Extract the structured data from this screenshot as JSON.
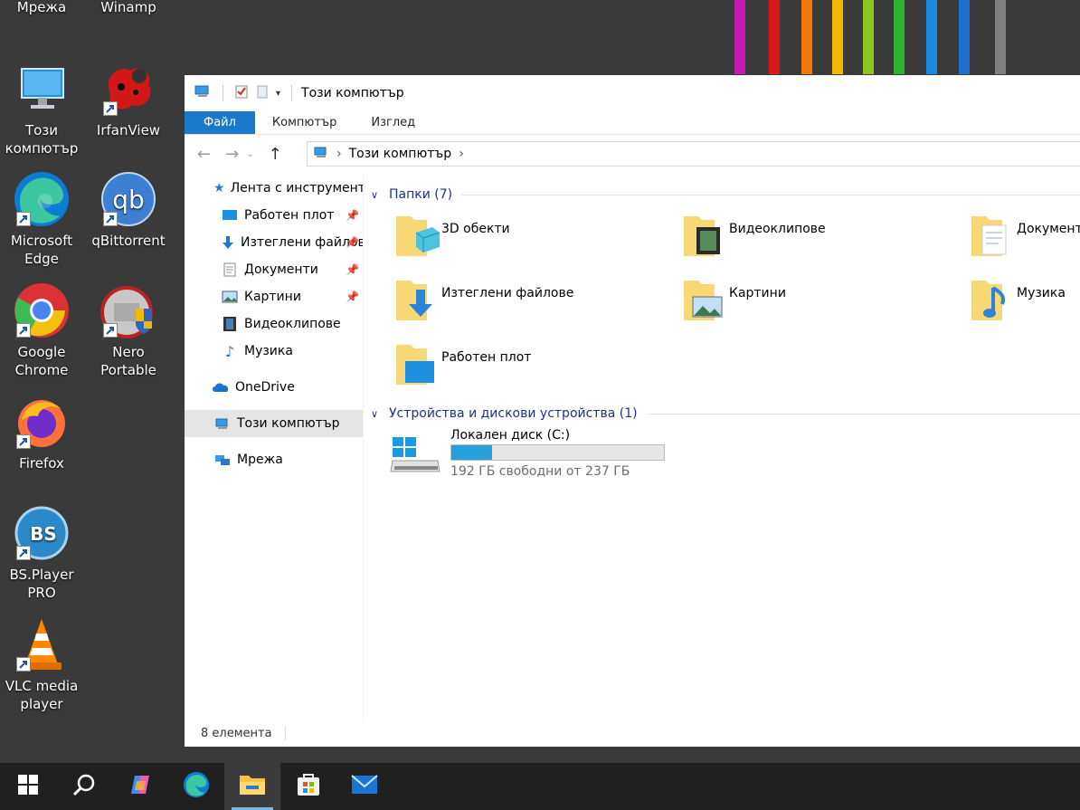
{
  "desktop": {
    "icons": [
      {
        "label": "Мрежа"
      },
      {
        "label": "Winamp"
      },
      {
        "label": "Този компютър"
      },
      {
        "label": "IrfanView"
      },
      {
        "label": "Microsoft Edge"
      },
      {
        "label": "qBittorrent"
      },
      {
        "label": "Google Chrome"
      },
      {
        "label": "Nero Portable"
      },
      {
        "label": "Firefox"
      },
      {
        "label": "BS.Player PRO"
      },
      {
        "label": "VLC media player"
      }
    ],
    "stripe_colors": [
      "#c51ab8",
      "#d81818",
      "#f0780a",
      "#f5b800",
      "#8fc41e",
      "#2bb52f",
      "#1a8be0",
      "#1e6fd0",
      "#808080"
    ]
  },
  "window": {
    "title": "Този компютър",
    "ribbon_tabs": [
      "Файл",
      "Компютър",
      "Изглед"
    ],
    "address": {
      "segment": "Този компютър"
    },
    "sidebar": {
      "items": [
        {
          "label": "Лента с инструменти"
        },
        {
          "label": "Работен плот"
        },
        {
          "label": "Изтеглени файлове"
        },
        {
          "label": "Документи"
        },
        {
          "label": "Картини"
        },
        {
          "label": "Видеоклипове"
        },
        {
          "label": "Музика"
        },
        {
          "label": "OneDrive"
        },
        {
          "label": "Този компютър"
        },
        {
          "label": "Мрежа"
        }
      ]
    },
    "folders_group": {
      "header": "Папки (7)",
      "items": [
        {
          "label": "3D обекти"
        },
        {
          "label": "Видеоклипове"
        },
        {
          "label": "Документи"
        },
        {
          "label": "Изтеглени файлове"
        },
        {
          "label": "Картини"
        },
        {
          "label": "Музика"
        },
        {
          "label": "Работен плот"
        }
      ]
    },
    "drives_group": {
      "header": "Устройства и дискови устройства (1)",
      "drive": {
        "label": "Локален диск (C:)",
        "free_text": "192 ГБ свободни от 237 ГБ",
        "used_fraction": 0.19
      }
    },
    "status": "8 елемента"
  },
  "taskbar": {
    "items": [
      "start-icon",
      "search-icon",
      "copilot-icon",
      "edge-icon",
      "file-explorer-icon",
      "store-icon",
      "mail-icon"
    ]
  }
}
